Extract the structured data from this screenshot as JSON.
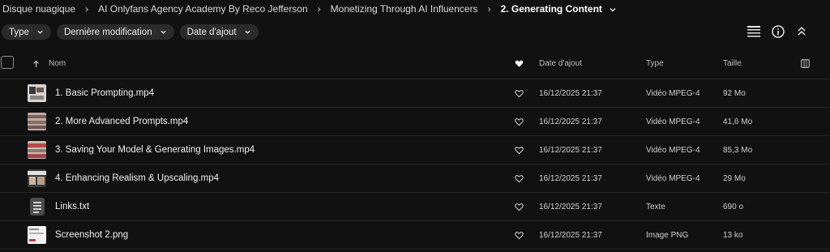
{
  "breadcrumb": {
    "items": [
      "Disque nuagique",
      "AI Onlyfans Agency Academy By Reco Jefferson",
      "Monetizing Through AI Influencers",
      "2. Generating Content"
    ]
  },
  "filters": {
    "type": "Type",
    "modified": "Dernière modification",
    "added": "Date d'ajout"
  },
  "toolbar": {
    "icons": [
      "list-view-icon",
      "info-icon",
      "collapse-icon"
    ]
  },
  "table": {
    "headers": {
      "name": "Nom",
      "date": "Date d'ajout",
      "type": "Type",
      "size": "Taille"
    },
    "rows": [
      {
        "name": "1. Basic Prompting.mp4",
        "date": "16/12/2025 21:37",
        "type": "Vidéo MPEG-4",
        "size": "92 Mo",
        "thumb": "video"
      },
      {
        "name": "2. More Advanced Prompts.mp4",
        "date": "16/12/2025 21:37",
        "type": "Vidéo MPEG-4",
        "size": "41,6 Mo",
        "thumb": "video"
      },
      {
        "name": "3. Saving Your Model & Generating Images.mp4",
        "date": "16/12/2025 21:37",
        "type": "Vidéo MPEG-4",
        "size": "85,3 Mo",
        "thumb": "video"
      },
      {
        "name": "4. Enhancing Realism & Upscaling.mp4",
        "date": "16/12/2025 21:37",
        "type": "Vidéo MPEG-4",
        "size": "29 Mo",
        "thumb": "video"
      },
      {
        "name": "Links.txt",
        "date": "16/12/2025 21:37",
        "type": "Texte",
        "size": "690 o",
        "thumb": "text"
      },
      {
        "name": "Screenshot 2.png",
        "date": "16/12/2025 21:37",
        "type": "Image PNG",
        "size": "13 ko",
        "thumb": "image"
      }
    ]
  },
  "colors": {
    "background": "#111111",
    "chip": "#2b2b2b",
    "divider": "#262626"
  }
}
